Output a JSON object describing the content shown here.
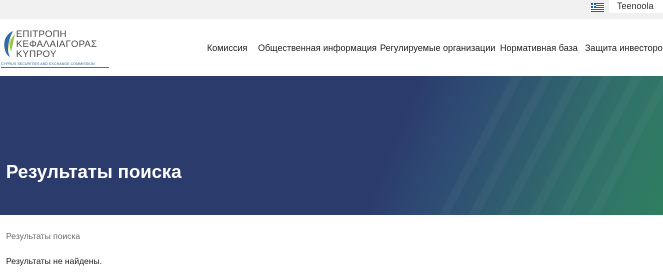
{
  "topbar": {
    "language_icon": "greek-flag-icon",
    "user_label": "Teenoola"
  },
  "logo": {
    "line1": "ΕΠΙΤΡΟΠΗ",
    "line2": "ΚΕΦΑΛΑΙΑΓΟΡΑΣ",
    "line3": "ΚΥΠΡΟΥ",
    "subtitle": "CYPRUS SECURITIES AND EXCHANGE COMMISSION",
    "mark_colors": [
      "#2d6ca8",
      "#8fc23f"
    ]
  },
  "nav": {
    "items": [
      "Комиссия",
      "Общественная информация",
      "Регулируемые организации",
      "Нормативная база",
      "Защита инвесторов"
    ]
  },
  "hero": {
    "title": "Результаты поиска",
    "colors": {
      "start": "#2b3b6c",
      "end": "#2f7f60"
    }
  },
  "breadcrumb": {
    "current": "Результаты поиска"
  },
  "results": {
    "message": "Результаты не найдены."
  }
}
